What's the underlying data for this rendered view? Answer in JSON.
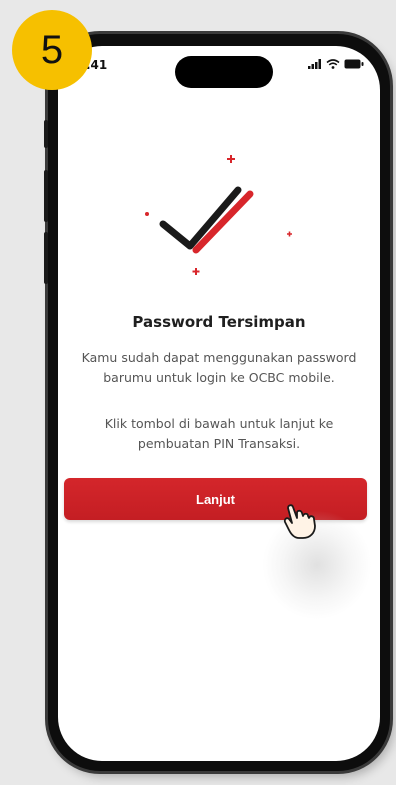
{
  "step_badge": "5",
  "status_bar": {
    "time": ".41"
  },
  "success": {
    "title": "Password Tersimpan",
    "message_1": "Kamu sudah dapat menggunakan password barumu untuk login ke OCBC mobile.",
    "message_2": "Klik tombol di bawah untuk lanjut ke pembuatan PIN Transaksi."
  },
  "continue_button": {
    "label": "Lanjut"
  },
  "colors": {
    "brand_red": "#d4262b",
    "badge_yellow": "#f6c000",
    "check_dark": "#1a1a1a"
  },
  "icons": [
    "checkmark-icon",
    "tap-hand-icon",
    "signal-icon",
    "wifi-icon",
    "battery-icon"
  ]
}
